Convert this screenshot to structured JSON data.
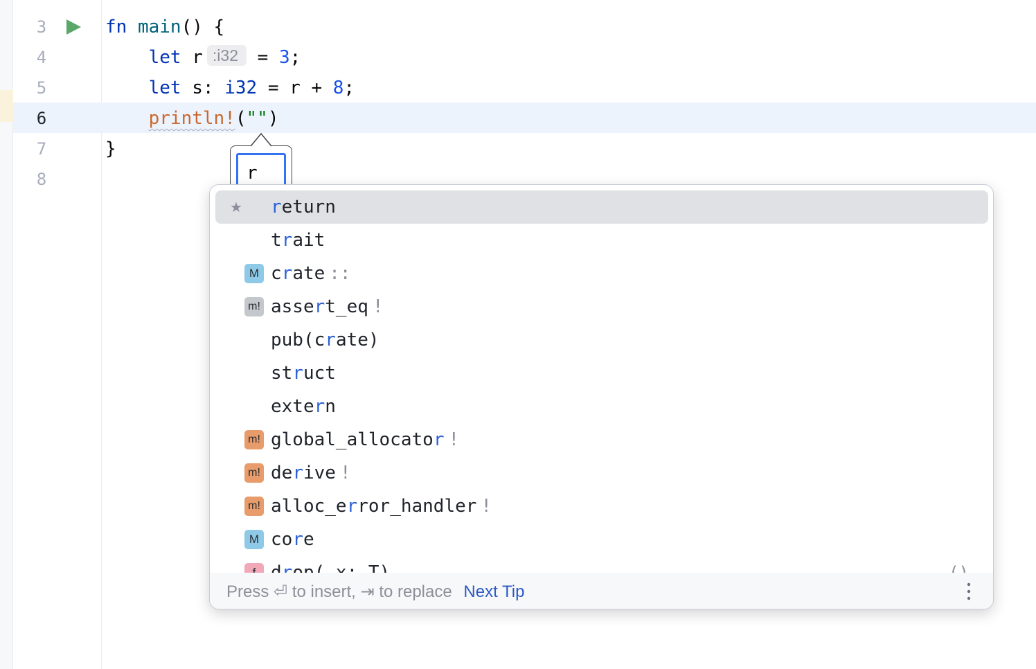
{
  "editor": {
    "line_numbers": [
      "3",
      "4",
      "5",
      "6",
      "7",
      "8"
    ],
    "active_line": "6",
    "lines": {
      "l3": {
        "kw": "fn",
        "name": "main",
        "rest": "() {"
      },
      "l4": {
        "kw": "let",
        "var": " r",
        "type_hint": ":i32",
        "rest": " = ",
        "num": "3",
        "end": ";"
      },
      "l5": {
        "kw": "let",
        "var": " s: ",
        "type": "i32",
        "rest": " = r + ",
        "num": "8",
        "end": ";"
      },
      "l6": {
        "macro": "println!",
        "open": "(",
        "str": "\"\"",
        "close": ")"
      },
      "l7": {
        "text": "}"
      }
    },
    "template_input_value": "r"
  },
  "completion": {
    "items": [
      {
        "icon": "",
        "star": "★",
        "pre": "",
        "hl": "r",
        "post": "eturn",
        "suffix": ""
      },
      {
        "icon": "",
        "star": "",
        "pre": "t",
        "hl": "r",
        "post": "ait",
        "suffix": ""
      },
      {
        "icon": "M",
        "star": "",
        "pre": "c",
        "hl": "r",
        "post": "ate",
        "suffix": "::"
      },
      {
        "icon": "m!",
        "star": "",
        "pre": "asse",
        "hl": "r",
        "post": "t_eq",
        "suffix": "!"
      },
      {
        "icon": "",
        "star": "",
        "pre": "pub(c",
        "hl": "r",
        "post": "ate)",
        "suffix": ""
      },
      {
        "icon": "",
        "star": "",
        "pre": "st",
        "hl": "r",
        "post": "uct",
        "suffix": ""
      },
      {
        "icon": "",
        "star": "",
        "pre": "exte",
        "hl": "r",
        "post": "n",
        "suffix": ""
      },
      {
        "icon": "m!",
        "star": "",
        "pre": "global_allocato",
        "hl": "r",
        "post": "",
        "suffix": "!"
      },
      {
        "icon": "m!",
        "star": "",
        "pre": "de",
        "hl": "r",
        "post": "ive",
        "suffix": "!"
      },
      {
        "icon": "m!",
        "star": "",
        "pre": "alloc_e",
        "hl": "r",
        "post": "ror_handler",
        "suffix": "!"
      },
      {
        "icon": "M",
        "star": "",
        "pre": "co",
        "hl": "r",
        "post": "e",
        "suffix": ""
      },
      {
        "icon": "f",
        "star": "",
        "pre": "d",
        "hl": "r",
        "post": "op(_x: T)",
        "suffix": "",
        "tail": "()"
      }
    ],
    "footer": {
      "press": "Press",
      "enter_symbol": "⏎",
      "to_insert": "to insert,",
      "tab_symbol": "⇥",
      "to_replace": "to replace",
      "next_tip": "Next Tip"
    }
  },
  "colors": {
    "keyword": "#0033b3",
    "function": "#00627a",
    "number": "#1750eb",
    "string": "#067d17",
    "macro": "#c7692e",
    "match_highlight": "#2d62d6",
    "link": "#2d5bc4",
    "run_icon": "#59a869"
  },
  "icons": {
    "run": "run-gutter-icon",
    "more": "more-vertical-icon",
    "star": "star-icon"
  }
}
